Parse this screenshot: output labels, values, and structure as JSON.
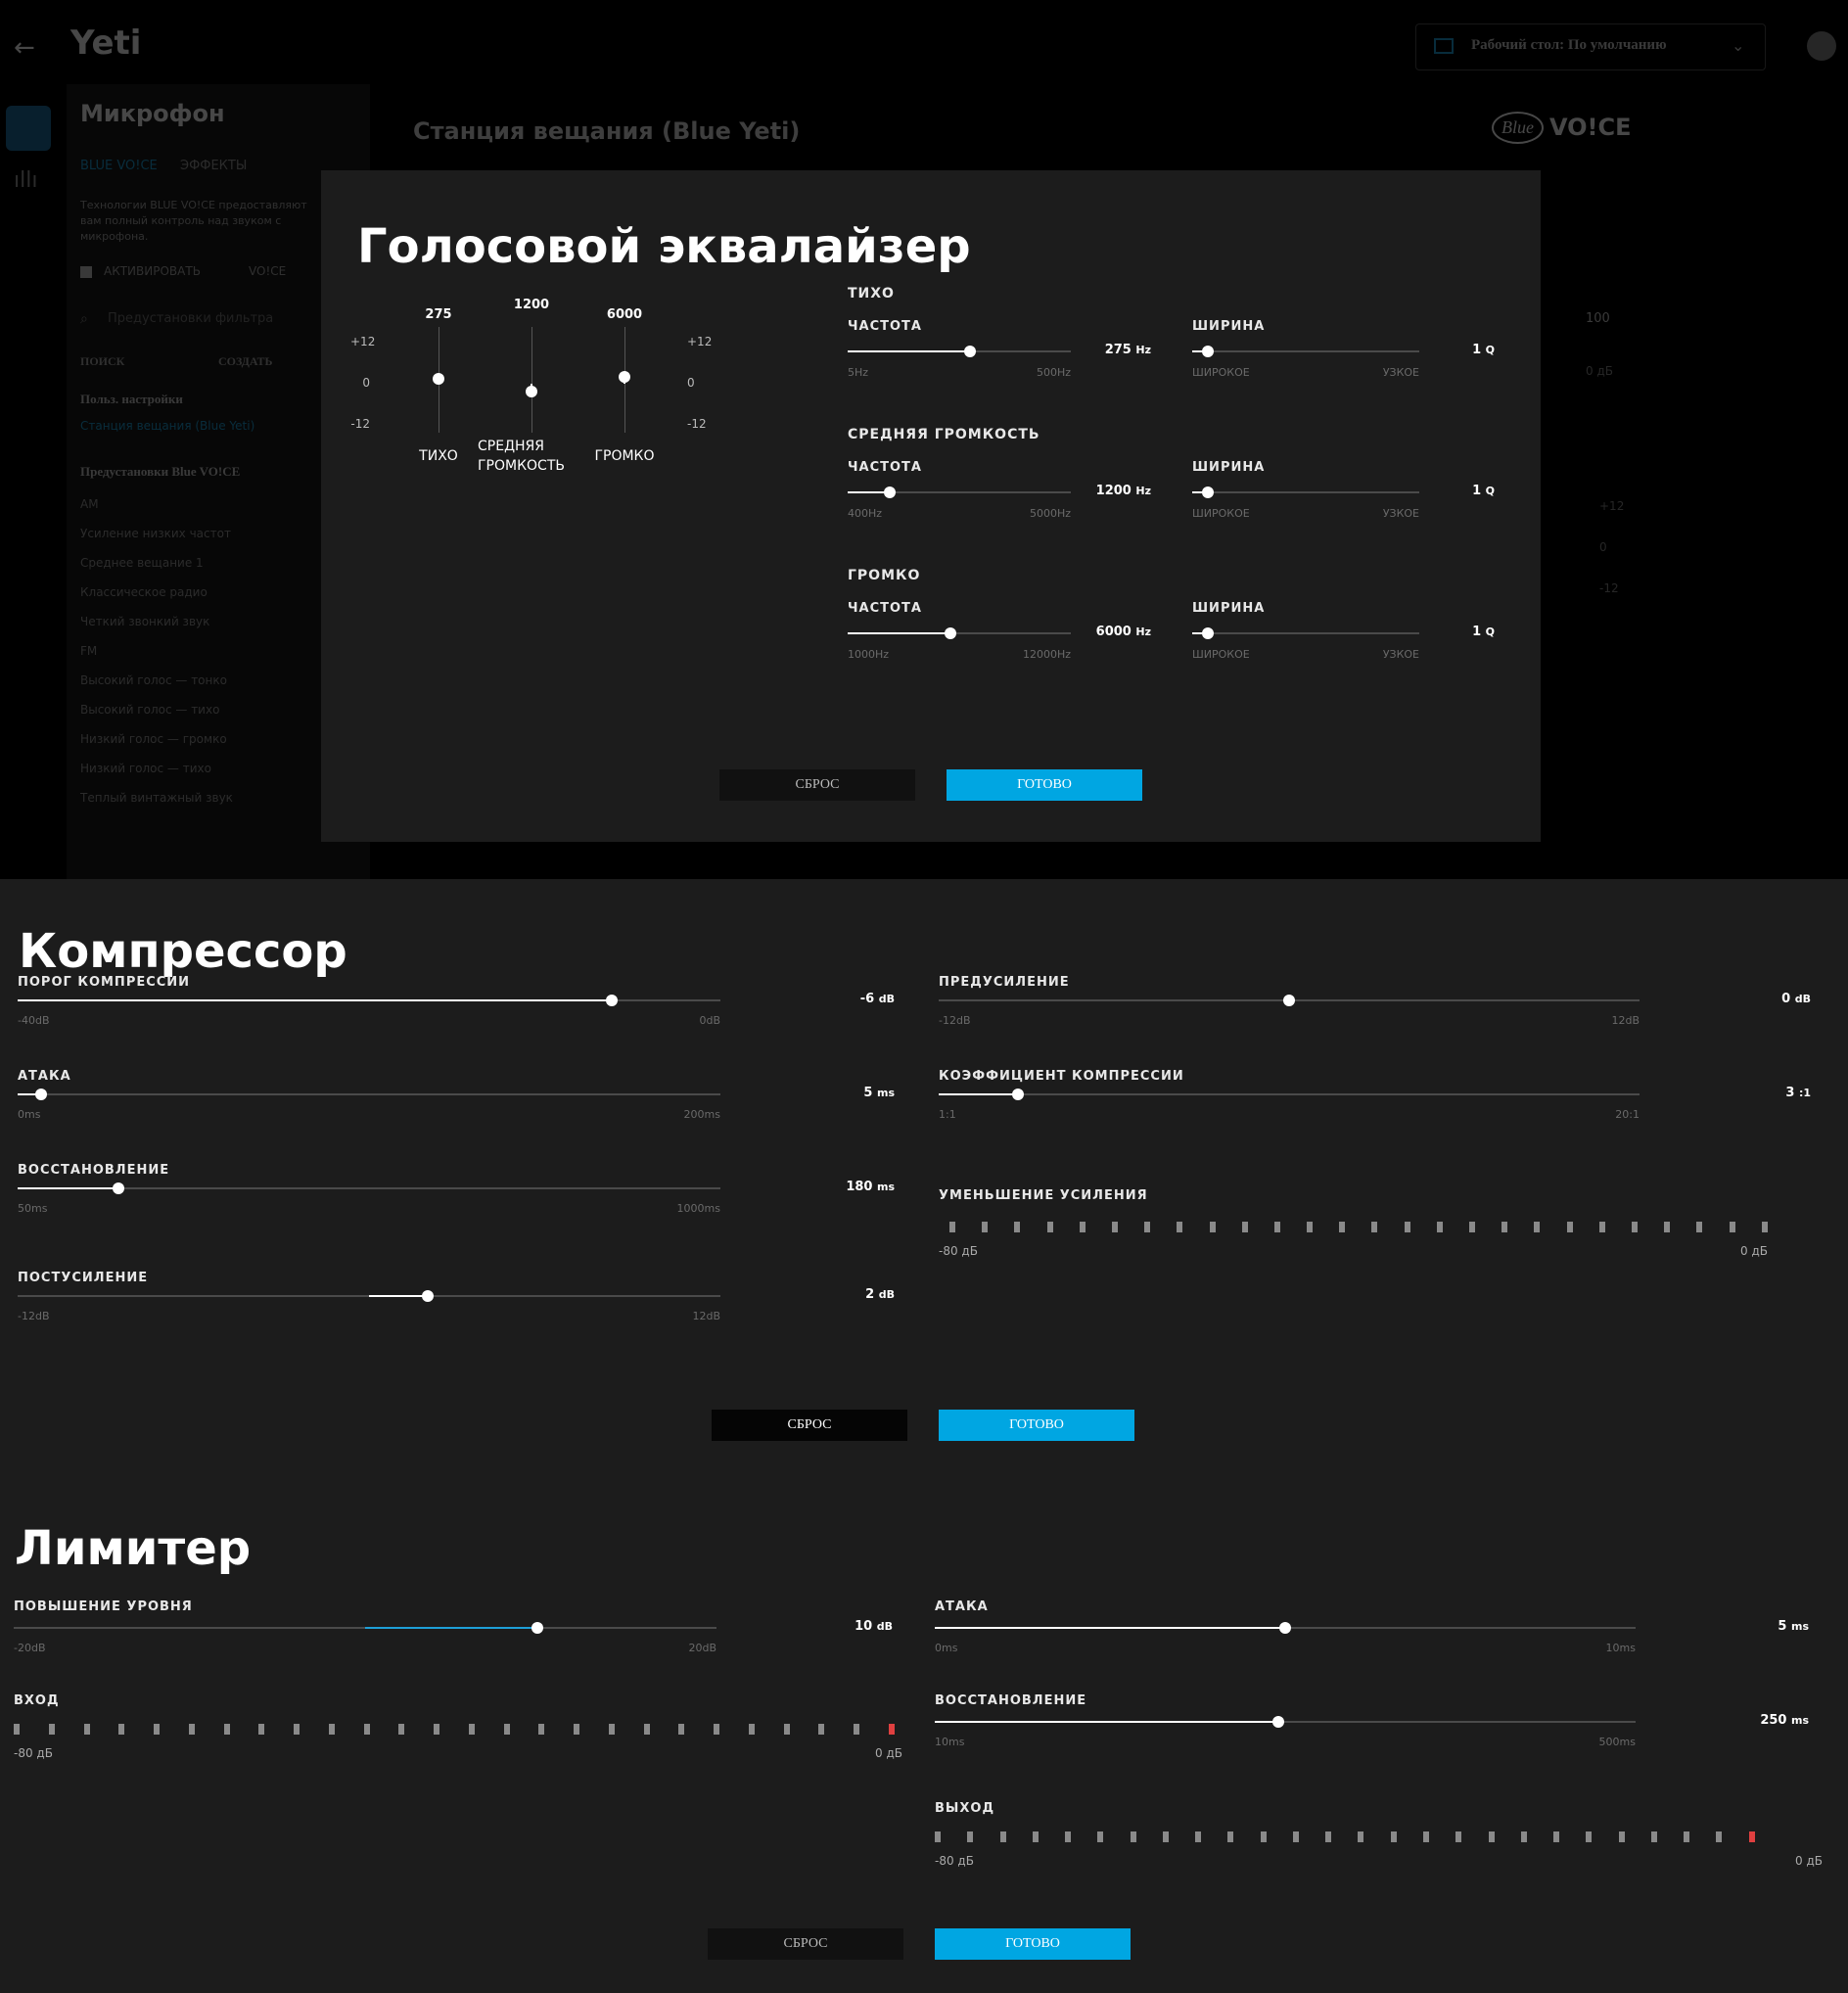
{
  "app": {
    "title": "Yeti",
    "profile": "Рабочий стол: По умолчанию",
    "sidebar_title": "Микрофон",
    "tabs": [
      "BLUE VO!CE",
      "ЭФФЕКТЫ"
    ],
    "description": "Технологии BLUE VO!CE предоставляют вам полный контроль над звуком с микрофона.",
    "activate_label": "АКТИВИРОВАТЬ",
    "activate_logo": "VO!CE",
    "filter_placeholder": "Предустановки фильтра",
    "search_label": "ПОИСК",
    "create_label": "СОЗДАТЬ",
    "user_settings_title": "Польз. настройки",
    "user_preset": "Станция вещания (Blue Yeti)",
    "blue_presets_title": "Предустановки Blue VO!CE",
    "presets": [
      "AM",
      "Усиление низких частот",
      "Среднее вещание 1",
      "Классическое радио",
      "Четкий звонкий звук",
      "FM",
      "Высокий голос — тонко",
      "Высокий голос — тихо",
      "Низкий голос — громко",
      "Низкий голос — тихо",
      "Теплый винтажный звук"
    ],
    "main_title": "Станция вещания (Blue Yeti)",
    "brand_logo": "VO!CE",
    "brand_logo_prefix": "Blue",
    "right_value": "100",
    "right_value_db": "0 дБ",
    "right_scale": [
      "+12",
      "0",
      "-12"
    ]
  },
  "equalizer": {
    "title": "Голосовой эквалайзер",
    "axis": {
      "top": "+12",
      "mid": "0",
      "bottom": "-12"
    },
    "bands": [
      {
        "freq": "275",
        "label": "ТИХО",
        "gain": 1.5
      },
      {
        "freq": "1200",
        "label": "СРЕДНЯЯ ГРОМКОСТЬ",
        "gain": -2.4
      },
      {
        "freq": "6000",
        "label": "ГРОМКО",
        "gain": 2.0
      }
    ],
    "sections": [
      {
        "title": "ТИХО",
        "freq_label": "ЧАСТОТА",
        "freq_value": "275",
        "freq_unit": "Hz",
        "freq_min": "5Hz",
        "freq_max": "500Hz",
        "freq_pos": 0.55,
        "width_label": "ШИРИНА",
        "width_value": "1",
        "width_unit": "Q",
        "width_min": "ШИРОКОЕ",
        "width_max": "УЗКОЕ",
        "width_pos": 0.07
      },
      {
        "title": "СРЕДНЯЯ ГРОМКОСТЬ",
        "freq_label": "ЧАСТОТА",
        "freq_value": "1200",
        "freq_unit": "Hz",
        "freq_min": "400Hz",
        "freq_max": "5000Hz",
        "freq_pos": 0.19,
        "width_label": "ШИРИНА",
        "width_value": "1",
        "width_unit": "Q",
        "width_min": "ШИРОКОЕ",
        "width_max": "УЗКОЕ",
        "width_pos": 0.07
      },
      {
        "title": "ГРОМКО",
        "freq_label": "ЧАСТОТА",
        "freq_value": "6000",
        "freq_unit": "Hz",
        "freq_min": "1000Hz",
        "freq_max": "12000Hz",
        "freq_pos": 0.46,
        "width_label": "ШИРИНА",
        "width_value": "1",
        "width_unit": "Q",
        "width_min": "ШИРОКОЕ",
        "width_max": "УЗКОЕ",
        "width_pos": 0.07
      }
    ],
    "reset_label": "СБРОС",
    "done_label": "ГОТОВО"
  },
  "compressor": {
    "title": "Компрессор",
    "sliders_left": [
      {
        "label": "ПОРОГ КОМПРЕССИИ",
        "value": "-6",
        "unit": "dB",
        "min": "-40dB",
        "max": "0dB",
        "pos": 0.845,
        "fill": "from-start"
      },
      {
        "label": "АТАКА",
        "value": "5",
        "unit": "ms",
        "min": "0ms",
        "max": "200ms",
        "pos": 0.034,
        "fill": "from-start"
      },
      {
        "label": "ВОССТАНОВЛЕНИЕ",
        "value": "180",
        "unit": "ms",
        "min": "50ms",
        "max": "1000ms",
        "pos": 0.143,
        "fill": "from-start"
      },
      {
        "label": "ПОСТУСИЛЕНИЕ",
        "value": "2",
        "unit": "dB",
        "min": "-12dB",
        "max": "12dB",
        "pos": 0.583,
        "fill": "from-center"
      }
    ],
    "sliders_right": [
      {
        "label": "ПРЕДУСИЛЕНИЕ",
        "value": "0",
        "unit": "dB",
        "min": "-12dB",
        "max": "12dB",
        "pos": 0.5,
        "fill": "none"
      },
      {
        "label": "КОЭФФИЦИЕНТ КОМПРЕССИИ",
        "value": "3",
        "unit": ":1",
        "min": "1:1",
        "max": "20:1",
        "pos": 0.113,
        "fill": "from-start"
      }
    ],
    "gain_reduction": {
      "label": "УМЕНЬШЕНИЕ УСИЛЕНИЯ",
      "min": "-80 дБ",
      "max": "0 дБ"
    },
    "reset_label": "СБРОС",
    "done_label": "ГОТОВО"
  },
  "limiter": {
    "title": "Лимитер",
    "boost": {
      "label": "ПОВЫШЕНИЕ УРОВНЯ",
      "value": "10",
      "unit": "dB",
      "min": "-20dB",
      "max": "20dB",
      "pos": 0.745
    },
    "input": {
      "label": "ВХОД",
      "min": "-80 дБ",
      "max": "0 дБ"
    },
    "sliders_right": [
      {
        "label": "АТАКА",
        "value": "5",
        "unit": "ms",
        "min": "0ms",
        "max": "10ms",
        "pos": 0.5
      },
      {
        "label": "ВОССТАНОВЛЕНИЕ",
        "value": "250",
        "unit": "ms",
        "min": "10ms",
        "max": "500ms",
        "pos": 0.49
      }
    ],
    "output": {
      "label": "ВЫХОД",
      "min": "-80 дБ",
      "max": "0 дБ"
    },
    "reset_label": "СБРОС",
    "done_label": "ГОТОВО"
  }
}
